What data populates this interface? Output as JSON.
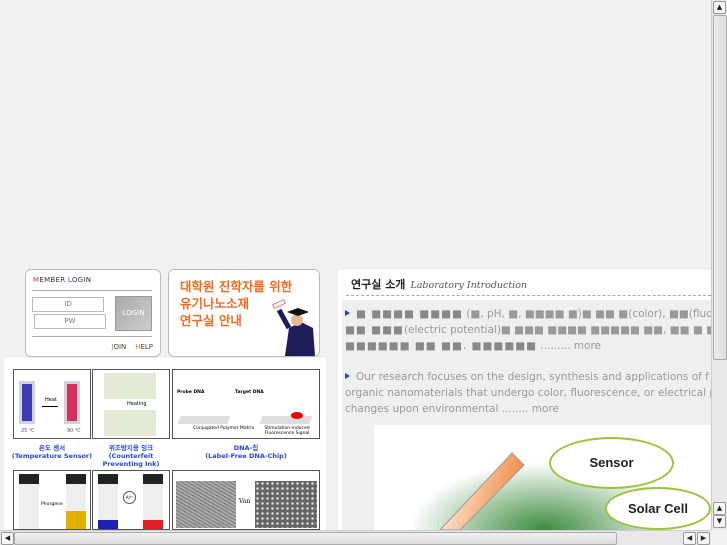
{
  "login": {
    "title_prefix_1": "M",
    "title_rest_1": "EMBER ",
    "title_prefix_2": "L",
    "title_rest_2": "OGIN",
    "id_placeholder": "ID",
    "pw_placeholder": "PW",
    "login_button": "LOGIN",
    "join_prefix": "J",
    "join_rest": "OIN",
    "help_prefix": "H",
    "help_rest": "ELP"
  },
  "banner": {
    "line1": "대학원 진학자를  위한",
    "line2": "유기나노소재",
    "line3": "연구실 안내"
  },
  "gallery": [
    {
      "title": "온도 센서",
      "subtitle": "(Temperature Sensor)",
      "labels": [
        "Heat",
        "25 ℃",
        "90 ℃"
      ]
    },
    {
      "title": "위조방지용 잉크",
      "subtitle": "(Counterfeit Preventing Ink)",
      "labels": [
        "Heating"
      ]
    },
    {
      "title": "DNA-칩",
      "subtitle": "(Label-Free DNA-Chip)",
      "labels": [
        "Probe DNA",
        "Target DNA",
        "Conjugated Polymer Matrix",
        "Stimulation-induced Fluorescence Signal"
      ]
    },
    {
      "labels": [
        "Phosgene"
      ]
    },
    {
      "labels": [
        "Al³⁺"
      ]
    },
    {
      "labels": [
        "Van"
      ]
    }
  ],
  "intro": {
    "heading_ko": "연구실 소개",
    "heading_en": "Laboratory Introduction",
    "para1_line1_blocks": "■ ■■■■ ■■■■",
    "para1_line1_rest": " (■, pH, ■, ■■■■ ■)■ ■■ ■(color), ■■(fluore",
    "para1_line2_blocks": "■■ ■■■",
    "para1_line2_rest": "(electric potential)■ ■■■ ■■■■ ■■■■■ ■■, ■■ ■ ■■",
    "para1_line3_blocks": "■■■■■■ ■■ ■■. ■■■■■■",
    "para1_more": " ......... more",
    "para2_line1": "Our research focuses on the design, synthesis and applications of f",
    "para2_line2": "organic nanomaterials that undergo color, fluorescence, or electrical p",
    "para2_line3": "changes upon environmental ........ more"
  },
  "diagram": {
    "sensor": "Sensor",
    "solar_cell": "Solar Cell"
  },
  "colors": {
    "accent_orange": "#f26b1d",
    "caption_blue": "#2448e0",
    "bullet_blue": "#1a3fd6",
    "ellipse_green": "#9bc43a"
  }
}
